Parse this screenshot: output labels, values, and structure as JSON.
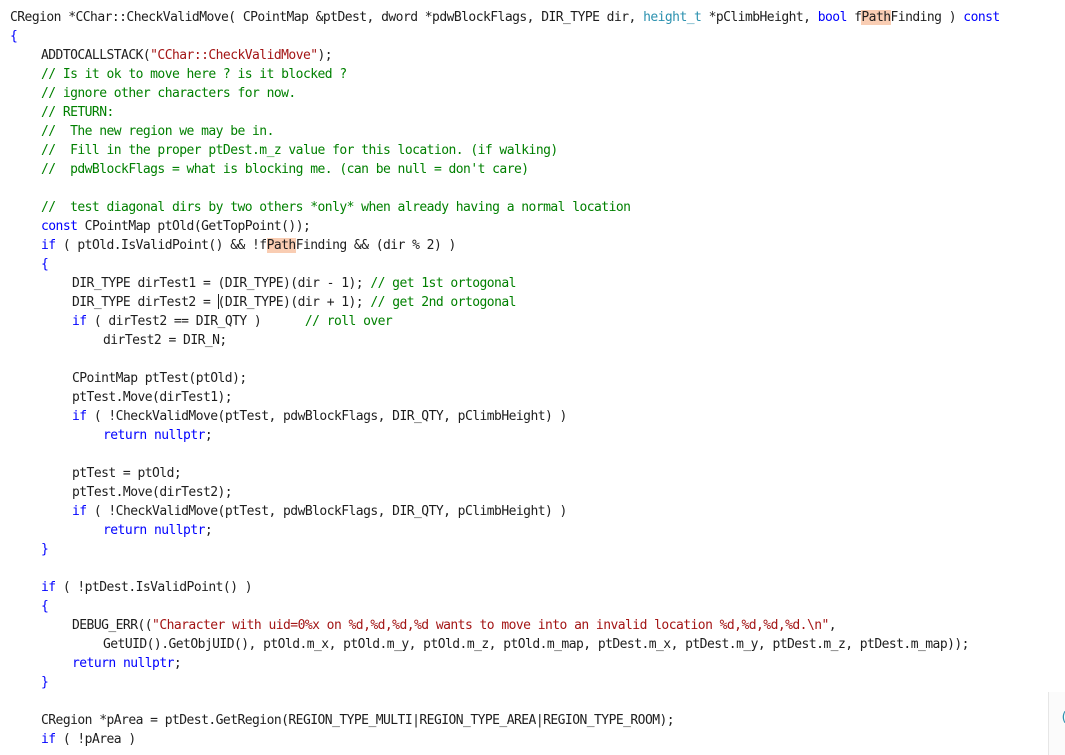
{
  "editor": {
    "lines": [
      {
        "indent": 0,
        "tokens": [
          [
            "p",
            "CRegion *CChar::CheckValidMove( CPointMap &ptDest, dword *pdwBlockFlags, DIR_TYPE dir, "
          ],
          [
            "ty",
            "height_t"
          ],
          [
            "p",
            " *pClimbHeight, "
          ],
          [
            "k",
            "bool"
          ],
          [
            "p",
            " f"
          ],
          [
            "h",
            "Path"
          ],
          [
            "p",
            "Finding ) "
          ],
          [
            "k",
            "const"
          ]
        ]
      },
      {
        "indent": 0,
        "tokens": [
          [
            "k",
            "{"
          ]
        ]
      },
      {
        "indent": 1,
        "tokens": [
          [
            "p",
            "ADDTOCALLSTACK("
          ],
          [
            "s",
            "\"CChar::CheckValidMove\""
          ],
          [
            "p",
            ");"
          ]
        ]
      },
      {
        "indent": 1,
        "tokens": [
          [
            "c",
            "// Is it ok to move here ? is it blocked ?"
          ]
        ]
      },
      {
        "indent": 1,
        "tokens": [
          [
            "c",
            "// ignore other characters for now."
          ]
        ]
      },
      {
        "indent": 1,
        "tokens": [
          [
            "c",
            "// RETURN:"
          ]
        ]
      },
      {
        "indent": 1,
        "tokens": [
          [
            "c",
            "//  The new region we may be in."
          ]
        ]
      },
      {
        "indent": 1,
        "tokens": [
          [
            "c",
            "//  Fill in the proper ptDest.m_z value for this location. (if walking)"
          ]
        ]
      },
      {
        "indent": 1,
        "tokens": [
          [
            "c",
            "//  pdwBlockFlags = what is blocking me. (can be null = don't care)"
          ]
        ]
      },
      {
        "indent": 0,
        "tokens": []
      },
      {
        "indent": 1,
        "tokens": [
          [
            "c",
            "//  test diagonal dirs by two others *only* when already having a normal location"
          ]
        ]
      },
      {
        "indent": 1,
        "tokens": [
          [
            "k",
            "const"
          ],
          [
            "p",
            " CPointMap ptOld(GetTopPoint());"
          ]
        ]
      },
      {
        "indent": 1,
        "tokens": [
          [
            "k",
            "if"
          ],
          [
            "p",
            " ( ptOld.IsValidPoint() && !f"
          ],
          [
            "h",
            "Path"
          ],
          [
            "p",
            "Finding && (dir % 2) )"
          ]
        ]
      },
      {
        "indent": 1,
        "tokens": [
          [
            "k",
            "{"
          ]
        ]
      },
      {
        "indent": 2,
        "tokens": [
          [
            "p",
            "DIR_TYPE dirTest1 = (DIR_TYPE)(dir - 1); "
          ],
          [
            "c",
            "// get 1st ortogonal"
          ]
        ]
      },
      {
        "indent": 2,
        "tokens": [
          [
            "p",
            "DIR_TYPE dirTest2 = "
          ],
          [
            "caret",
            ""
          ],
          [
            "p",
            "(DIR_TYPE)(dir + 1); "
          ],
          [
            "c",
            "// get 2nd ortogonal"
          ]
        ]
      },
      {
        "indent": 2,
        "tokens": [
          [
            "k",
            "if"
          ],
          [
            "p",
            " ( dirTest2 == DIR_QTY )      "
          ],
          [
            "c",
            "// roll over"
          ]
        ]
      },
      {
        "indent": 3,
        "tokens": [
          [
            "p",
            "dirTest2 = DIR_N;"
          ]
        ]
      },
      {
        "indent": 0,
        "tokens": []
      },
      {
        "indent": 2,
        "tokens": [
          [
            "p",
            "CPointMap ptTest(ptOld);"
          ]
        ]
      },
      {
        "indent": 2,
        "tokens": [
          [
            "p",
            "ptTest.Move(dirTest1);"
          ]
        ]
      },
      {
        "indent": 2,
        "tokens": [
          [
            "k",
            "if"
          ],
          [
            "p",
            " ( !CheckValidMove(ptTest, pdwBlockFlags, DIR_QTY, pClimbHeight) )"
          ]
        ]
      },
      {
        "indent": 3,
        "tokens": [
          [
            "k",
            "return"
          ],
          [
            "p",
            " "
          ],
          [
            "k",
            "nullptr"
          ],
          [
            "p",
            ";"
          ]
        ]
      },
      {
        "indent": 0,
        "tokens": []
      },
      {
        "indent": 2,
        "tokens": [
          [
            "p",
            "ptTest = ptOld;"
          ]
        ]
      },
      {
        "indent": 2,
        "tokens": [
          [
            "p",
            "ptTest.Move(dirTest2);"
          ]
        ]
      },
      {
        "indent": 2,
        "tokens": [
          [
            "k",
            "if"
          ],
          [
            "p",
            " ( !CheckValidMove(ptTest, pdwBlockFlags, DIR_QTY, pClimbHeight) )"
          ]
        ]
      },
      {
        "indent": 3,
        "tokens": [
          [
            "k",
            "return"
          ],
          [
            "p",
            " "
          ],
          [
            "k",
            "nullptr"
          ],
          [
            "p",
            ";"
          ]
        ]
      },
      {
        "indent": 1,
        "tokens": [
          [
            "k",
            "}"
          ]
        ]
      },
      {
        "indent": 0,
        "tokens": []
      },
      {
        "indent": 1,
        "tokens": [
          [
            "k",
            "if"
          ],
          [
            "p",
            " ( !ptDest.IsValidPoint() )"
          ]
        ]
      },
      {
        "indent": 1,
        "tokens": [
          [
            "k",
            "{"
          ]
        ]
      },
      {
        "indent": 2,
        "tokens": [
          [
            "p",
            "DEBUG_ERR(("
          ],
          [
            "s",
            "\"Character with uid=0%x on %d,%d,%d,%d wants to move into an invalid location %d,%d,%d,%d.\\n\""
          ],
          [
            "p",
            ","
          ]
        ]
      },
      {
        "indent": 3,
        "tokens": [
          [
            "p",
            "GetUID().GetObjUID(), ptOld.m_x, ptOld.m_y, ptOld.m_z, ptOld.m_map, ptDest.m_x, ptDest.m_y, ptDest.m_z, ptDest.m_map));"
          ]
        ]
      },
      {
        "indent": 2,
        "tokens": [
          [
            "k",
            "return"
          ],
          [
            "p",
            " "
          ],
          [
            "k",
            "nullptr"
          ],
          [
            "p",
            ";"
          ]
        ]
      },
      {
        "indent": 1,
        "tokens": [
          [
            "k",
            "}"
          ]
        ]
      },
      {
        "indent": 0,
        "tokens": []
      },
      {
        "indent": 1,
        "tokens": [
          [
            "p",
            "CRegion *pArea = ptDest.GetRegion(REGION_TYPE_MULTI|REGION_TYPE_AREA|REGION_TYPE_ROOM);"
          ]
        ]
      },
      {
        "indent": 1,
        "tokens": [
          [
            "k",
            "if"
          ],
          [
            "p",
            " ( !pArea )"
          ]
        ]
      }
    ],
    "side_glyph": "("
  }
}
